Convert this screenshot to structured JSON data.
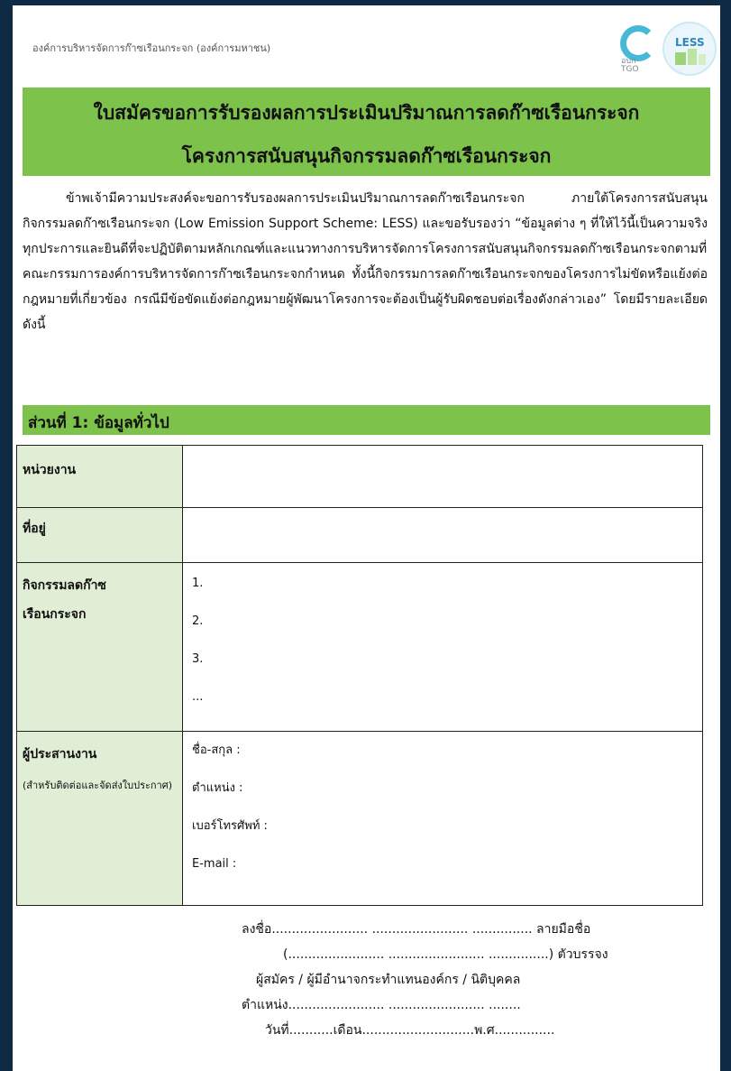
{
  "header": {
    "org_name": "องค์การบริหารจัดการก๊าซเรือนกระจก (องค์การมหาชน)",
    "logo_c_text": "อบก TGO",
    "logo_less_text": "LESS"
  },
  "title": {
    "line1": "ใบสมัครขอการรับรองผลการประเมินปริมาณการลดก๊าซเรือนกระจก",
    "line2": "โครงการสนับสนุนกิจกรรมลดก๊าซเรือนกระจก"
  },
  "intro": "ข้าพเจ้ามีความประสงค์จะขอการรับรองผลการประเมินปริมาณการลดก๊าซเรือนกระจก ภายใต้โครงการสนับสนุนกิจกรรมลดก๊าซเรือนกระจก (Low Emission Support Scheme: LESS) และขอรับรองว่า “ข้อมูลต่าง ๆ ที่ให้ไว้นี้เป็นความจริงทุกประการและยินดีที่จะปฏิบัติตามหลักเกณฑ์และแนวทางการบริหารจัดการโครงการสนับสนุนกิจกรรมลดก๊าซเรือนกระจกตามที่คณะกรรมการองค์การบริหารจัดการก๊าซเรือนกระจกกำหนด ทั้งนี้กิจกรรมการลดก๊าซเรือนกระจกของโครงการไม่ขัดหรือแย้งต่อกฎหมายที่เกี่ยวข้อง กรณีมีข้อขัดแย้งต่อกฎหมายผู้พัฒนาโครงการจะต้องเป็นผู้รับผิดชอบต่อเรื่องดังกล่าวเอง” โดยมีรายละเอียดดังนี้",
  "section1": {
    "title": "ส่วนที่ 1: ข้อมูลทั่วไป",
    "agency_label": "หน่วยงาน",
    "address_label": "ที่อยู่",
    "activity_label_line1": "กิจกรรมลดก๊าซ",
    "activity_label_line2": "เรือนกระจก",
    "activity_items": [
      "1.",
      "2.",
      "3.",
      "..."
    ],
    "coordinator_label": "ผู้ประสานงาน",
    "coordinator_note": "(สำหรับติดต่อและจัดส่งใบประกาศ)",
    "coordinator_fields": [
      "ชื่อ-สกุล :",
      "ตำแหน่ง :",
      "เบอร์โทรศัพท์ :",
      "E-mail :"
    ]
  },
  "signature": {
    "line1": "ลงชื่อ........................ ........................ ............... ลายมือชื่อ",
    "line2": "(........................ ........................ ...............) ตัวบรรจง",
    "line3": "ผู้สมัคร / ผู้มีอำนาจกระทำแทนองค์กร / นิติบุคคล",
    "line4": "ตำแหน่ง........................ ........................ ........",
    "line5": "วันที่...........เดือน............................พ.ศ..............."
  }
}
